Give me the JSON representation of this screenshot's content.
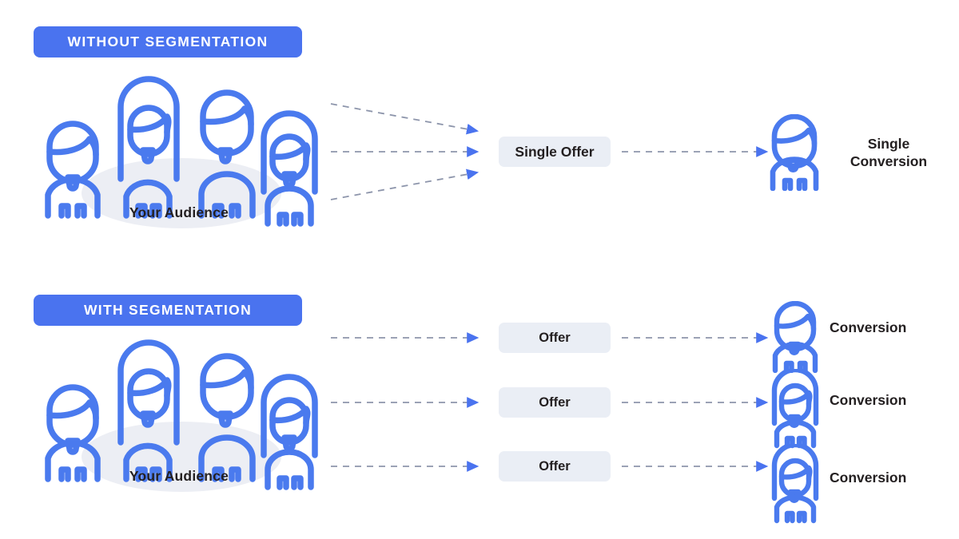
{
  "colors": {
    "brand_blue": "#4a73ef",
    "icon_blue": "#4a7aee",
    "box_bg": "#eaeef5",
    "ellipse_bg": "#eceef4",
    "text_dark": "#231f20",
    "dash_gray": "#8d95ab",
    "background": "#ffffff"
  },
  "sections": [
    {
      "id": "without-segmentation",
      "badge_label": "WITHOUT SEGMENTATION",
      "audience_label": "Your Audience",
      "audience_people": [
        {
          "type": "male",
          "name": "audience-person-male-1"
        },
        {
          "type": "female",
          "name": "audience-person-female-1"
        },
        {
          "type": "male",
          "name": "audience-person-male-2"
        },
        {
          "type": "female",
          "name": "audience-person-female-2"
        }
      ],
      "offers": [
        {
          "label": "Single Offer"
        }
      ],
      "conversions": [
        {
          "label": "Single\nConversion",
          "line1": "Single",
          "line2": "Conversion",
          "icon": "male"
        }
      ],
      "inbound_arrow_count": 3,
      "outbound_arrow_count": 1
    },
    {
      "id": "with-segmentation",
      "badge_label": "WITH SEGMENTATION",
      "audience_label": "Your Audience",
      "audience_people": [
        {
          "type": "male",
          "name": "audience-person-male-1"
        },
        {
          "type": "female",
          "name": "audience-person-female-1"
        },
        {
          "type": "male",
          "name": "audience-person-male-2"
        },
        {
          "type": "female",
          "name": "audience-person-female-2"
        }
      ],
      "offers": [
        {
          "label": "Offer"
        },
        {
          "label": "Offer"
        },
        {
          "label": "Offer"
        }
      ],
      "conversions": [
        {
          "label": "Conversion",
          "icon": "male"
        },
        {
          "label": "Conversion",
          "icon": "female"
        },
        {
          "label": "Conversion",
          "icon": "female"
        }
      ],
      "inbound_arrow_count": 3,
      "outbound_arrow_count": 3
    }
  ]
}
